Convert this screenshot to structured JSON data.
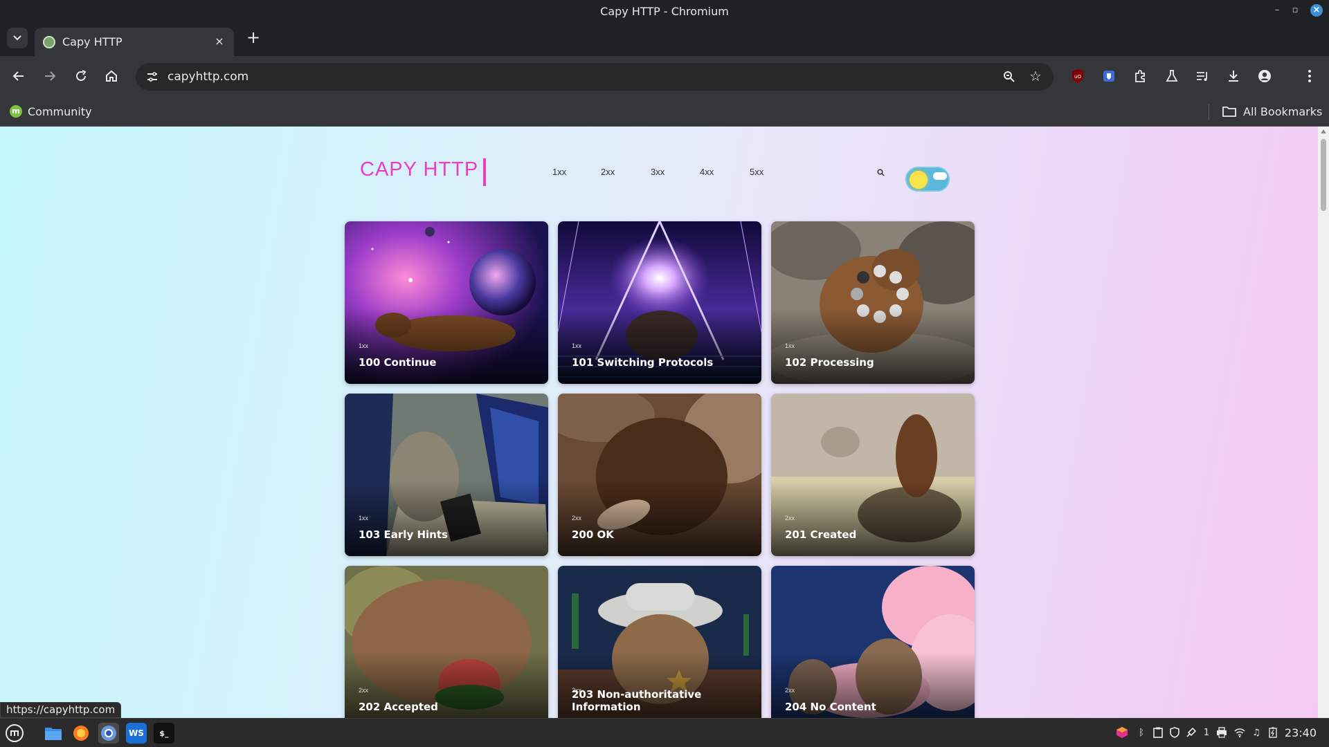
{
  "window": {
    "title": "Capy HTTP - Chromium"
  },
  "tabs": [
    {
      "title": "Capy HTTP",
      "favicon": "capybara-favicon"
    }
  ],
  "address_bar": {
    "url": "capyhttp.com"
  },
  "bookmarks_bar": {
    "items": [
      {
        "label": "Community",
        "icon": "linux-mint-icon"
      }
    ],
    "all_bookmarks_label": "All Bookmarks"
  },
  "site": {
    "logo": "CAPY HTTP",
    "nav": [
      "1xx",
      "2xx",
      "3xx",
      "4xx",
      "5xx"
    ],
    "theme": "light",
    "accent_color": "#e83ec6"
  },
  "cards": [
    {
      "category": "1xx",
      "title": "100 Continue",
      "scene": "space-nebula"
    },
    {
      "category": "1xx",
      "title": "101 Switching Protocols",
      "scene": "neon-triangle"
    },
    {
      "category": "1xx",
      "title": "102 Processing",
      "scene": "rocks-loading-spinner"
    },
    {
      "category": "1xx",
      "title": "103 Early Hints",
      "scene": "computer-desk"
    },
    {
      "category": "2xx",
      "title": "200 OK",
      "scene": "petting"
    },
    {
      "category": "2xx",
      "title": "201 Created",
      "scene": "tortoise"
    },
    {
      "category": "2xx",
      "title": "202 Accepted",
      "scene": "watermelon"
    },
    {
      "category": "2xx",
      "title": "203 Non-authoritative Information",
      "scene": "sheriff"
    },
    {
      "category": "2xx",
      "title": "204 No Content",
      "scene": "clouds"
    }
  ],
  "status_bar": {
    "hover_url": "https://capyhttp.com"
  },
  "taskbar": {
    "apps": [
      "mint-menu-icon",
      "files-icon",
      "firefox-icon",
      "chromium-icon",
      "webstorm-icon",
      "terminal-icon"
    ],
    "tray_workspace": "1",
    "clock": "23:40"
  }
}
